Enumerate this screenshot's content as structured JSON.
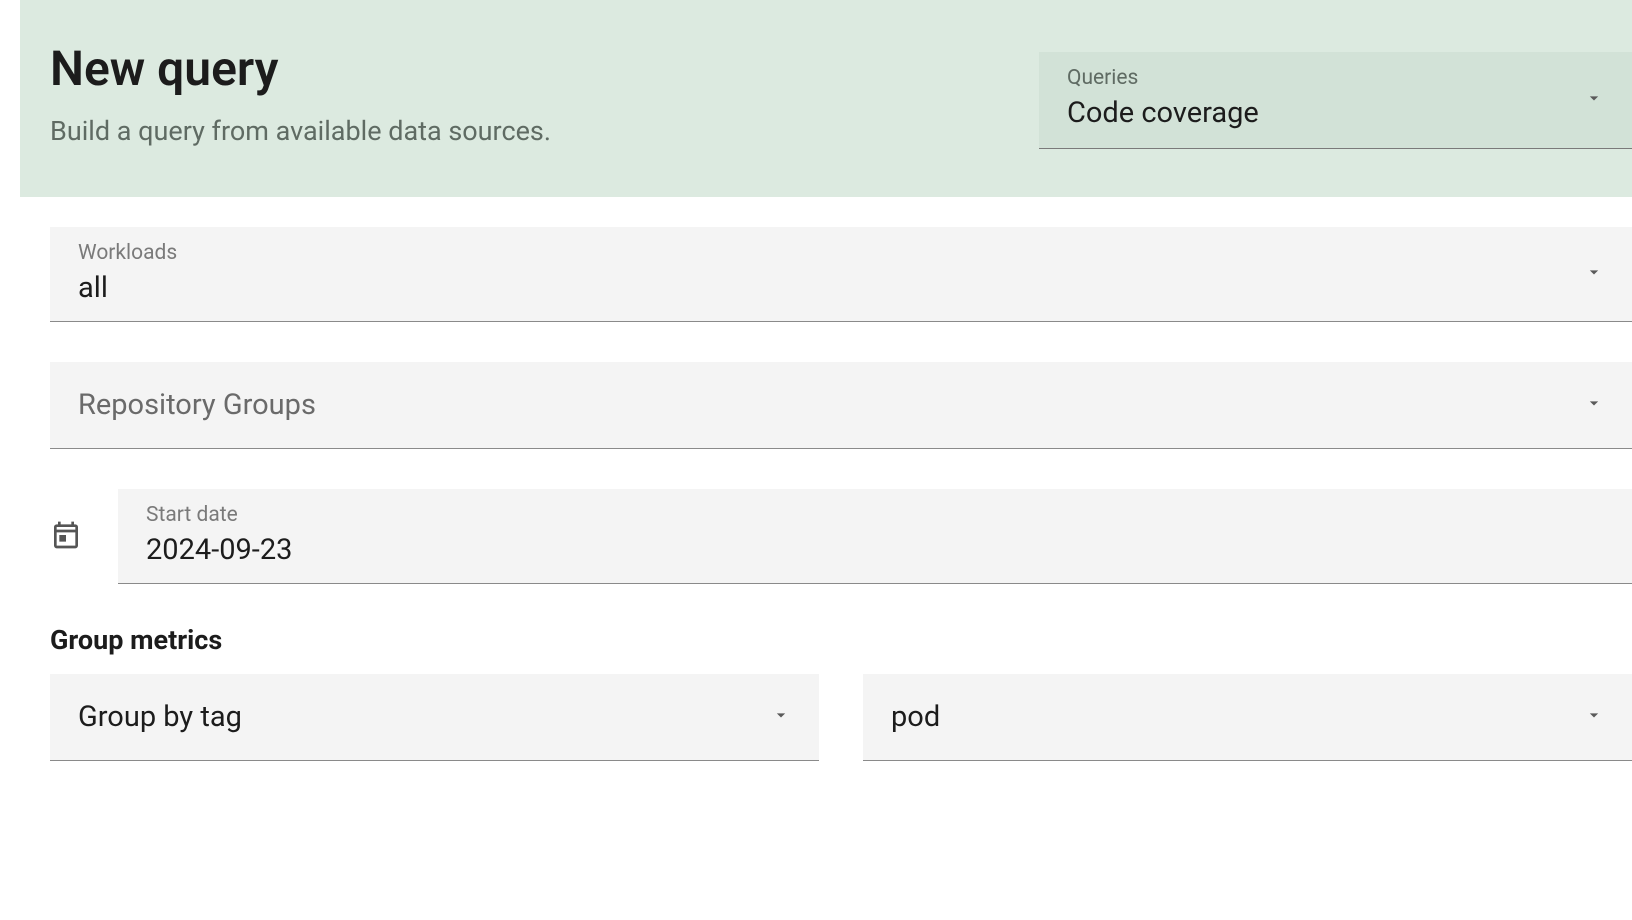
{
  "header": {
    "title": "New query",
    "subtitle": "Build a query from available data sources.",
    "queries": {
      "label": "Queries",
      "value": "Code coverage"
    }
  },
  "fields": {
    "workloads": {
      "label": "Workloads",
      "value": "all"
    },
    "repository_groups": {
      "placeholder": "Repository Groups"
    },
    "start_date": {
      "label": "Start date",
      "value": "2024-09-23"
    }
  },
  "group_metrics": {
    "heading": "Group metrics",
    "group_by": {
      "value": "Group by tag"
    },
    "tag": {
      "value": "pod"
    }
  }
}
